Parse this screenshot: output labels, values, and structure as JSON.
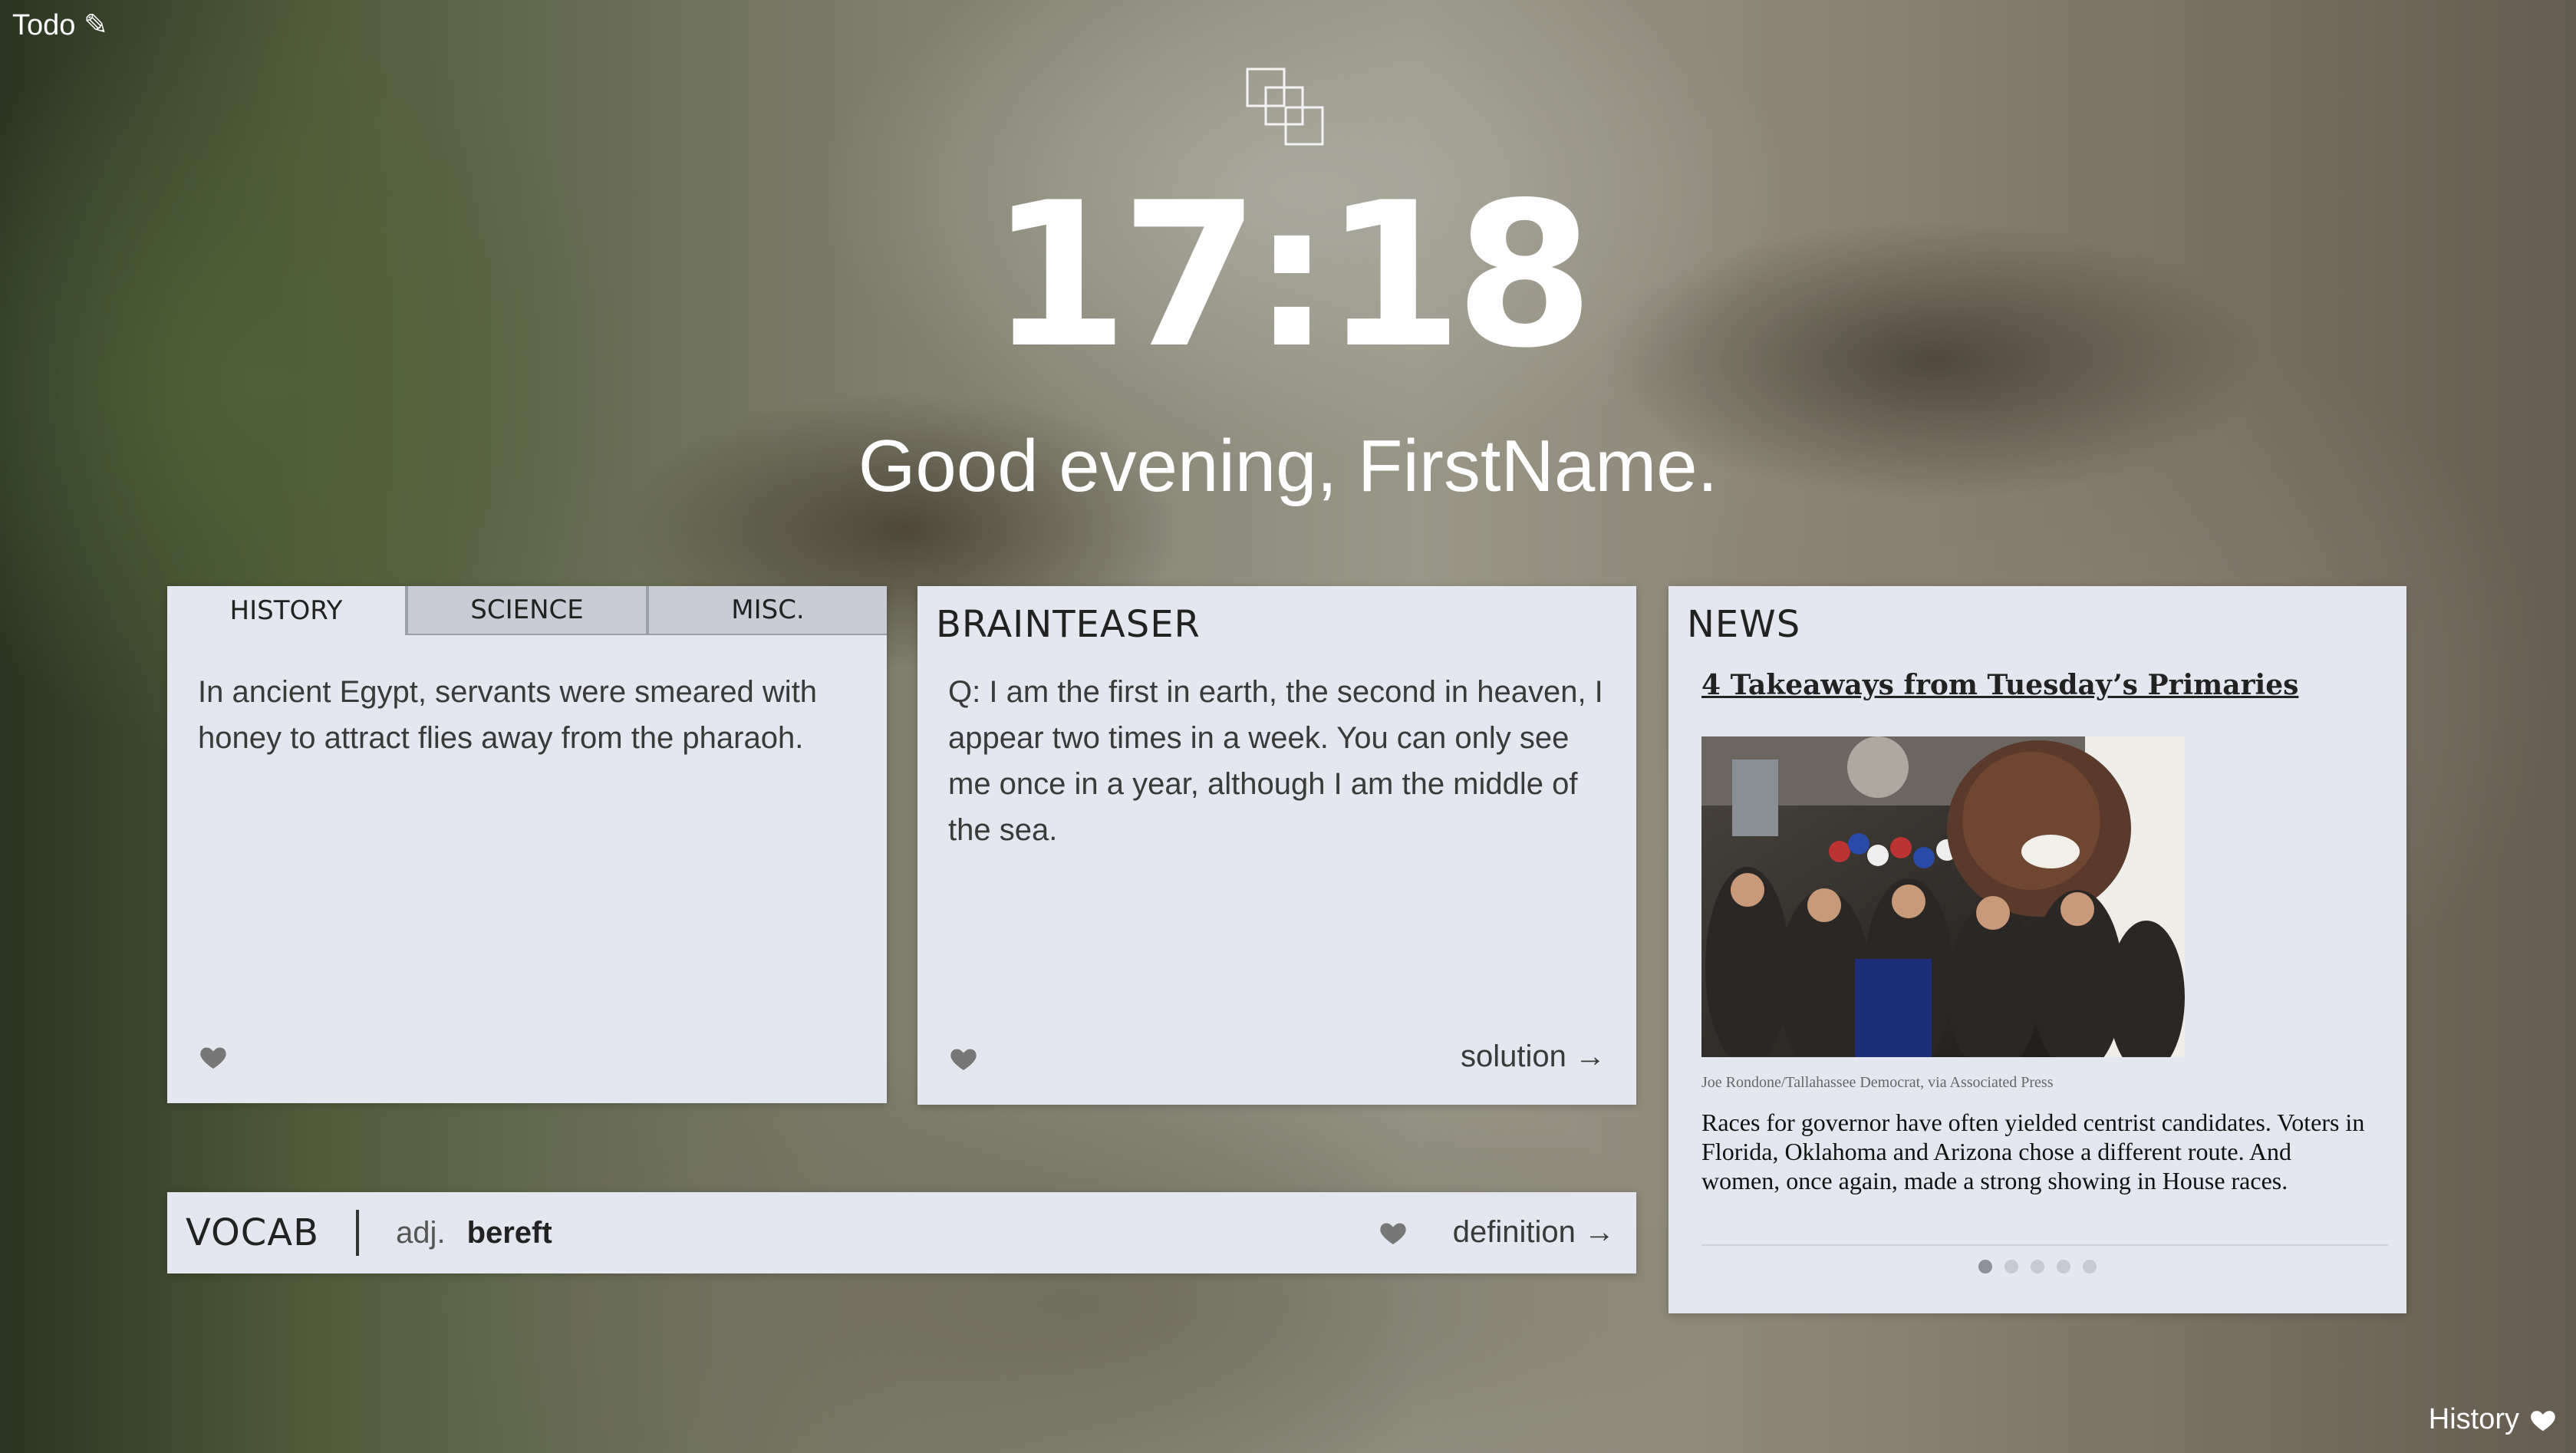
{
  "todo": {
    "label": "Todo",
    "icon": "pencil-icon"
  },
  "history": {
    "label": "History",
    "icon": "heart-icon"
  },
  "clock": {
    "time": "17:18"
  },
  "greeting": {
    "text": "Good evening, FirstName."
  },
  "facts": {
    "tabs": [
      {
        "label": "HISTORY",
        "active": true
      },
      {
        "label": "SCIENCE",
        "active": false
      },
      {
        "label": "MISC.",
        "active": false
      }
    ],
    "text": "In ancient Egypt, servants were smeared with honey to attract flies away from the pharaoh."
  },
  "brainteaser": {
    "title": "BRAINTEASER",
    "question": "Q: I am the first in earth, the second in heaven, I appear two times in a week. You can only see me once in a year, although I am the middle of the sea.",
    "solution_label": "solution →"
  },
  "vocab": {
    "title": "VOCAB",
    "pos": "adj.",
    "word": "bereft",
    "definition_label": "definition →"
  },
  "news": {
    "title": "NEWS",
    "headline": "4 Takeaways from Tuesday’s Primaries",
    "credit": "Joe Rondone/Tallahassee Democrat, via Associated Press",
    "summary": "Races for governor have often yielded centrist candidates. Voters in Florida, Oklahoma and Arizona chose a different route. And women, once again, made a strong showing in House races.",
    "page_count": 5,
    "active_page": 1
  },
  "colors": {
    "card_bg": "#e4e7ef",
    "text": "#333333",
    "heart": "#777777"
  }
}
